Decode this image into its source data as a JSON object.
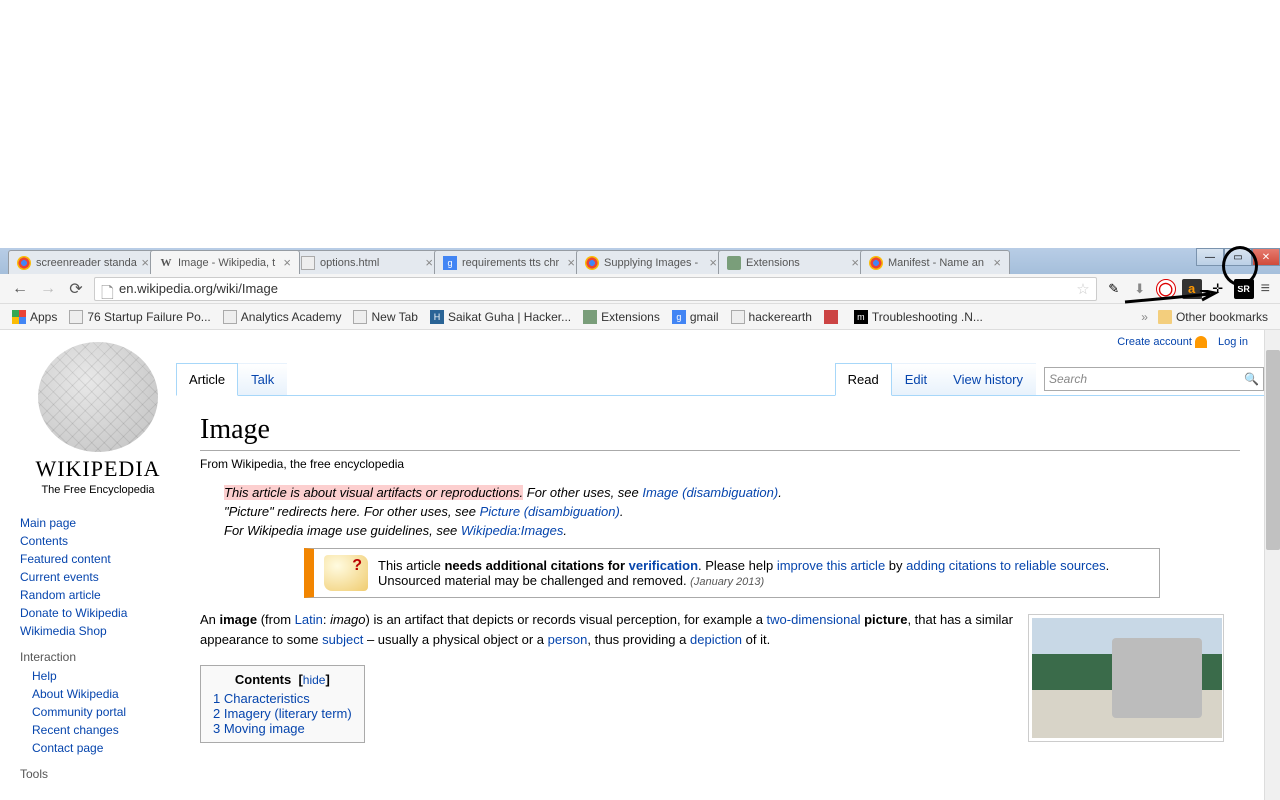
{
  "tabs": [
    {
      "title": "screenreader standa",
      "icon": "chrome"
    },
    {
      "title": "Image - Wikipedia, t",
      "icon": "wiki",
      "active": true
    },
    {
      "title": "options.html",
      "icon": "file"
    },
    {
      "title": "requirements tts chr",
      "icon": "google"
    },
    {
      "title": "Supplying Images -",
      "icon": "chrome"
    },
    {
      "title": "Extensions",
      "icon": "puzzle"
    },
    {
      "title": "Manifest - Name an",
      "icon": "chrome"
    }
  ],
  "url": "en.wikipedia.org/wiki/Image",
  "bookmarks_bar": {
    "apps": "Apps",
    "items": [
      {
        "label": "76 Startup Failure Po..."
      },
      {
        "label": "Analytics Academy"
      },
      {
        "label": "New Tab"
      },
      {
        "label": "Saikat Guha | Hacker..."
      },
      {
        "label": "Extensions"
      },
      {
        "label": "gmail"
      },
      {
        "label": "hackerearth"
      },
      {
        "label": ""
      },
      {
        "label": "Troubleshooting .N..."
      }
    ],
    "other": "Other bookmarks"
  },
  "ext_icons": [
    "pen",
    "download",
    "adblock",
    "amazon",
    "sr"
  ],
  "wiki": {
    "wordmark": "WIKIPEDIA",
    "tagline": "The Free Encyclopedia",
    "toplinks": {
      "create": "Create account",
      "login": "Log in"
    },
    "nav_main": [
      "Main page",
      "Contents",
      "Featured content",
      "Current events",
      "Random article",
      "Donate to Wikipedia",
      "Wikimedia Shop"
    ],
    "nav_interaction_heading": "Interaction",
    "nav_interaction": [
      "Help",
      "About Wikipedia",
      "Community portal",
      "Recent changes",
      "Contact page"
    ],
    "nav_tools_heading": "Tools",
    "tabs_left": {
      "article": "Article",
      "talk": "Talk"
    },
    "tabs_right": {
      "read": "Read",
      "edit": "Edit",
      "history": "View history"
    },
    "search_placeholder": "Search",
    "title": "Image",
    "subtitle": "From Wikipedia, the free encyclopedia",
    "hatnote1_highlight": "This article is about visual artifacts or reproductions.",
    "hatnote1_rest": " For other uses, see ",
    "hatnote1_link": "Image (disambiguation)",
    "hatnote2_a": "\"Picture\" redirects here. For other uses, see ",
    "hatnote2_link": "Picture (disambiguation)",
    "hatnote3_a": "For Wikipedia image use guidelines, see ",
    "hatnote3_link": "Wikipedia:Images",
    "ambox": {
      "pre": "This article ",
      "bold": "needs additional citations for ",
      "verif": "verification",
      "post1": ". Please help ",
      "improve": "improve this article",
      "post2": " by ",
      "adding": "adding citations to reliable sources",
      "post3": ". Unsourced material may be challenged and removed. ",
      "date": "(January 2013)"
    },
    "body": {
      "t1": "An ",
      "b1": "image",
      "t2": " (from ",
      "l1": "Latin",
      "t3": ": ",
      "i1": "imago",
      "t4": ") is an artifact that depicts or records visual perception, for example a ",
      "l2": "two-dimensional",
      "t5": " ",
      "b2": "picture",
      "t6": ", that has a similar appearance to some ",
      "l3": "subject",
      "t7": " – usually a physical object or a ",
      "l4": "person",
      "t8": ", thus providing a ",
      "l5": "depiction",
      "t9": " of it."
    },
    "toc": {
      "title": "Contents",
      "hide": "hide",
      "items": [
        "1 Characteristics",
        "2 Imagery (literary term)",
        "3 Moving image"
      ]
    }
  }
}
